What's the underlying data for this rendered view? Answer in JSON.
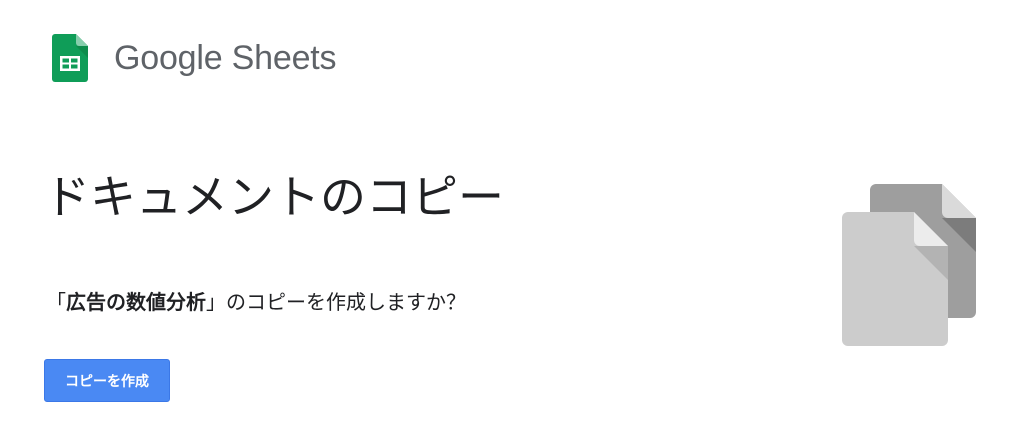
{
  "header": {
    "product_name": "Google Sheets",
    "logo_icon": "sheets-logo-icon",
    "logo_color": "#0f9d58"
  },
  "dialog": {
    "title": "ドキュメントのコピー",
    "question_prefix": "「",
    "document_name": "広告の数値分析",
    "question_suffix": "」のコピーを作成しますか？",
    "primary_button_label": "コピーを作成",
    "primary_button_color": "#4a89f3"
  },
  "illustration": {
    "icon": "copy-documents-icon",
    "back_color": "#9e9e9e",
    "front_color": "#cccccc"
  }
}
